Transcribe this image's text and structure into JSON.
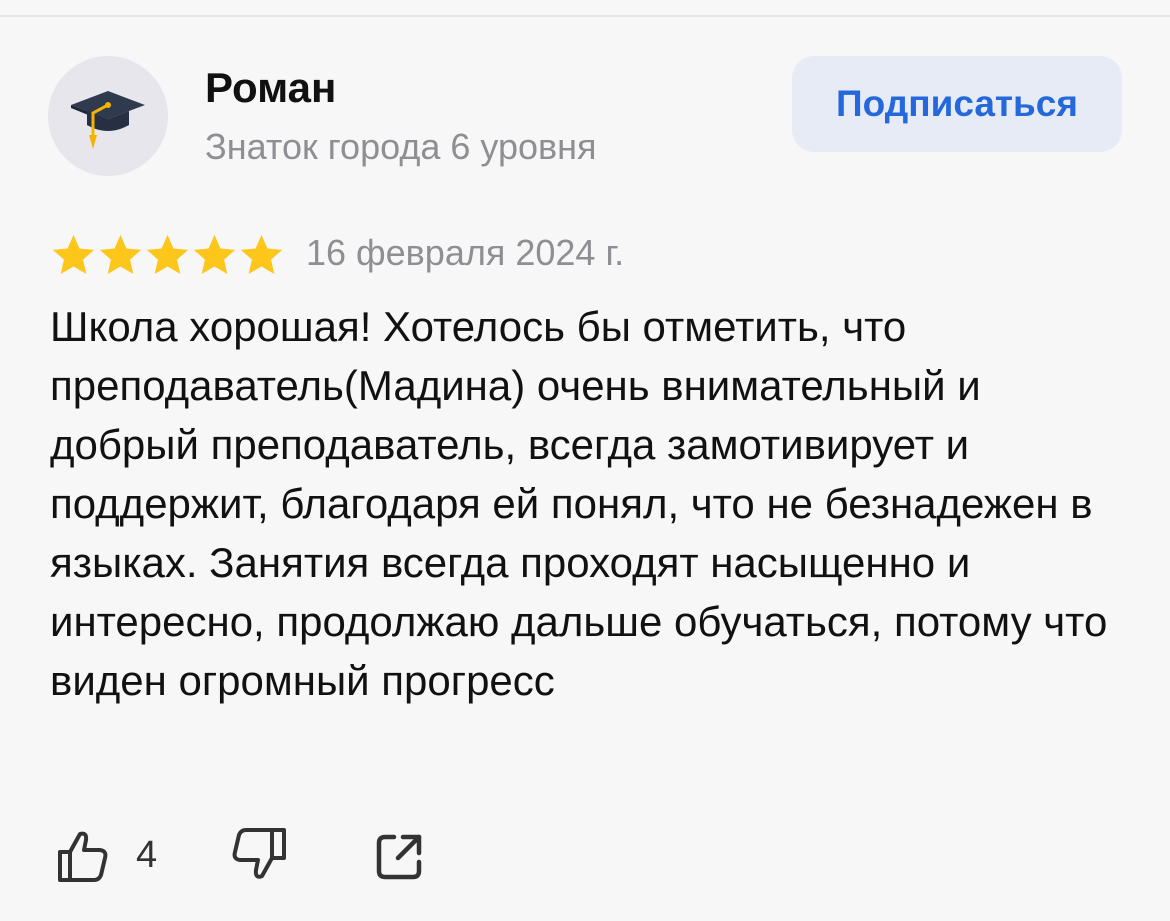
{
  "author": {
    "name": "Роман",
    "level": "Знаток города 6 уровня",
    "avatar_icon": "graduation-cap-icon"
  },
  "subscribe_button": {
    "label": "Подписаться"
  },
  "review": {
    "rating": 5,
    "rating_max": 5,
    "date": "16 февраля 2024 г.",
    "text": "Школа хорошая! Хотелось бы отметить, что преподаватель(Мадина) очень внимательный и добрый преподаватель, всегда замотивирует и поддержит, благодаря ей понял, что не безнадежен в языках. Занятия всегда проходят насыщенно и интересно, продолжаю дальше обучаться, потому что виден огромный прогресс"
  },
  "actions": {
    "likes_count": "4",
    "like_icon": "thumbs-up-icon",
    "dislike_icon": "thumbs-down-icon",
    "share_icon": "share-icon"
  },
  "colors": {
    "accent": "#2468dc",
    "star": "#fdc61a",
    "secondary_text": "#8e8e93",
    "background": "#f7f7f7"
  }
}
